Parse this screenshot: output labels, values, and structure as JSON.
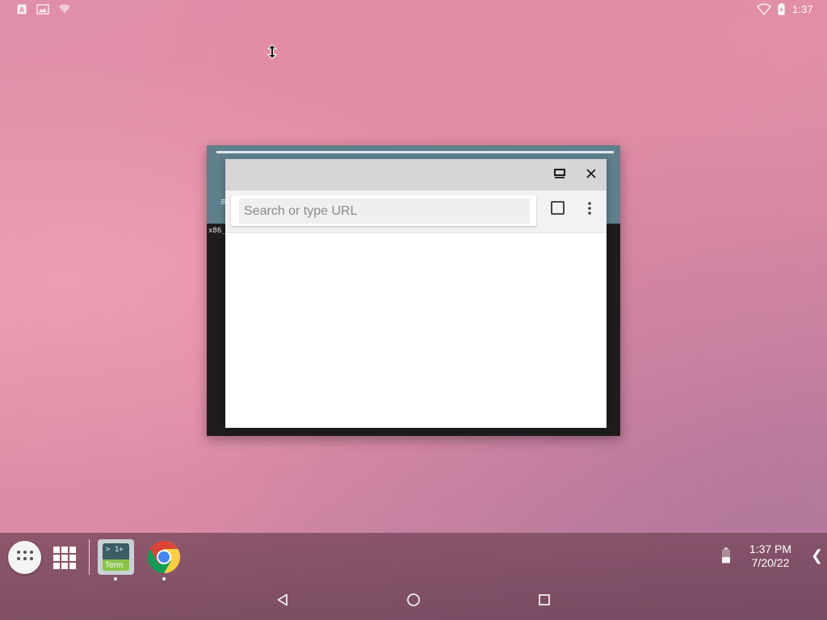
{
  "status_bar": {
    "left_icons": [
      "keyboard-a-icon",
      "image-notification-icon",
      "signal-notification-icon"
    ],
    "right_icons": [
      "wifi-icon",
      "battery-charging-icon"
    ],
    "time": "1:37"
  },
  "terminal_window": {
    "visible_text": "x86_"
  },
  "browser": {
    "title_icons": [
      "restore-window-icon",
      "close-icon"
    ],
    "url_placeholder": "Search or type URL",
    "url_value": "",
    "toolbar_icons": [
      "tab-switcher-icon",
      "more-vert-icon"
    ]
  },
  "taskbar": {
    "apps": [
      {
        "name": "Terminal",
        "label_top": "> 1+",
        "label_bottom": "Term",
        "running": true
      },
      {
        "name": "Chrome",
        "running": true
      }
    ],
    "clock_time": "1:37 PM",
    "clock_date": "7/20/22"
  },
  "nav_bar": {
    "buttons": [
      "back-icon",
      "home-icon",
      "recents-icon"
    ]
  },
  "colors": {
    "wallpaper": "#e18ea8",
    "terminal_header": "#5e7f8b",
    "browser_titlebar": "#d6d6d6",
    "terminal_app_accent": "#8bc34a"
  }
}
